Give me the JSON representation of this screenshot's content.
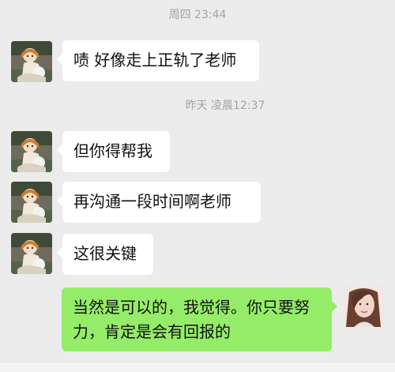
{
  "chat": {
    "timestamps": [
      "周四 23:44",
      "昨天 凌晨12:37"
    ],
    "messages": [
      {
        "sender": "contact",
        "text": "啧 好像走上正轨了老师"
      },
      {
        "sender": "contact",
        "text": "但你得帮我"
      },
      {
        "sender": "contact",
        "text": "再沟通一段时间啊老师"
      },
      {
        "sender": "contact",
        "text": "这很关键"
      },
      {
        "sender": "self",
        "text": "当然是可以的，我觉得。你只要努力，肯定是会有回报的"
      }
    ]
  },
  "colors": {
    "background": "#ececec",
    "contact_bubble": "#ffffff",
    "self_bubble": "#95ec69",
    "timestamp_text": "#a4a4a4"
  },
  "icons": {
    "contact_avatar": "cartoon-avatar-icon",
    "self_avatar": "user-photo-avatar-icon"
  }
}
